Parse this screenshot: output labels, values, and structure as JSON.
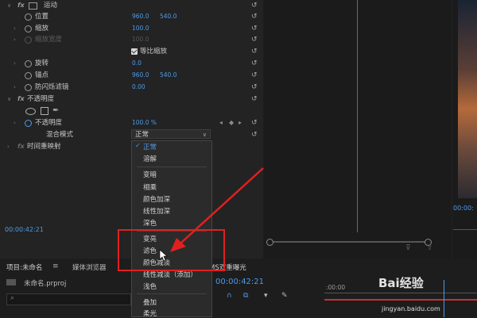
{
  "effect_controls": {
    "motion": {
      "label": "运动"
    },
    "position": {
      "label": "位置",
      "x": "960.0",
      "y": "540.0"
    },
    "scale": {
      "label": "缩放",
      "value": "100.0"
    },
    "scale_width": {
      "label": "缩放宽度",
      "value": "100.0"
    },
    "uniform_scale": {
      "label": "等比缩放",
      "checked": true
    },
    "rotation": {
      "label": "旋转",
      "value": "0.0"
    },
    "anchor": {
      "label": "锚点",
      "x": "960.0",
      "y": "540.0"
    },
    "antiflicker": {
      "label": "防闪烁滤镜",
      "value": "0.00"
    },
    "opacity_group": {
      "label": "不透明度"
    },
    "opacity": {
      "label": "不透明度",
      "value": "100.0 %"
    },
    "blend_mode": {
      "label": "混合模式",
      "value": "正常"
    },
    "time_remap": {
      "label": "时间重映射"
    },
    "timecode": "00:00:42:21"
  },
  "blend_menu": {
    "items": [
      "正常",
      "溶解",
      "变暗",
      "相乘",
      "颜色加深",
      "线性加深",
      "深色",
      "变亮",
      "滤色",
      "颜色减淡",
      "线性减淡（添加）",
      "浅色",
      "叠加",
      "柔光"
    ],
    "selected": "正常"
  },
  "bottom": {
    "project_tab": "项目:未命名",
    "media_browser_tab": "媒体浏览器",
    "project_file": "未命名.prproj",
    "sequence_tab": "MS双重曝光",
    "timecode": "00:00:42:21",
    "ruler_time": ":00:00"
  },
  "viewer": {
    "timecode": "00:00:"
  },
  "watermark": {
    "brand": "Bai经验",
    "url": "jingyan.baidu.com"
  },
  "colors": {
    "accent": "#4d9ae8",
    "annotation": "#e02020"
  }
}
